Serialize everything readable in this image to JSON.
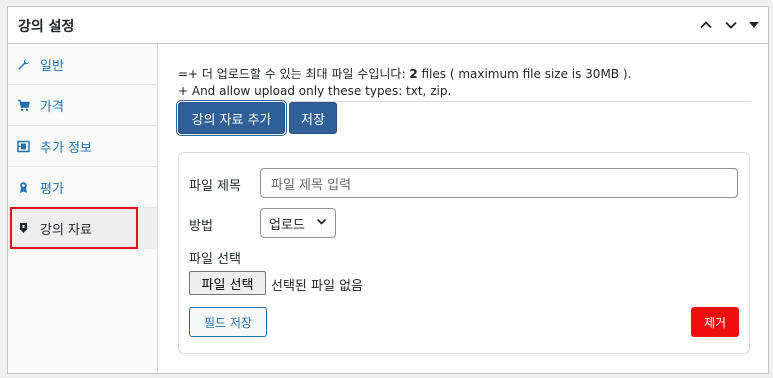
{
  "metabox": {
    "title": "강의 설정",
    "collapse_up_icon": "chevron-up-icon",
    "collapse_down_icon": "chevron-down-icon",
    "toggle_icon": "caret-down-icon"
  },
  "sidebar": {
    "items": [
      {
        "label": "일반",
        "icon": "wrench-icon"
      },
      {
        "label": "가격",
        "icon": "cart-icon"
      },
      {
        "label": "추가 정보",
        "icon": "film-icon"
      },
      {
        "label": "평가",
        "icon": "award-icon"
      },
      {
        "label": "강의 자료",
        "icon": "download-icon",
        "active": true
      }
    ]
  },
  "main": {
    "note_prefix": "=+ 더 업로드할 수 있는 최대 파일 수입니다: ",
    "note_count": "2",
    "note_suffix": " files ( maximum file size is 30MB ).",
    "note_line2": "+ And allow upload only these types: txt, zip.",
    "add_material_button": "강의 자료 추가",
    "save_button": "저장"
  },
  "card": {
    "file_title_label": "파일 제목",
    "file_title_placeholder": "파일 제목 입력",
    "method_label": "방법",
    "method_value": "업로드",
    "file_select_label": "파일 선택",
    "file_choose_button": "파일 선택",
    "file_status": "선택된 파일 없음",
    "save_field_button": "필드 저장",
    "remove_button": "제거"
  },
  "colors": {
    "accent": "#2271b1",
    "primary_button": "#2f5f97",
    "danger": "#ed0f0f",
    "highlight": "#e3101a"
  }
}
